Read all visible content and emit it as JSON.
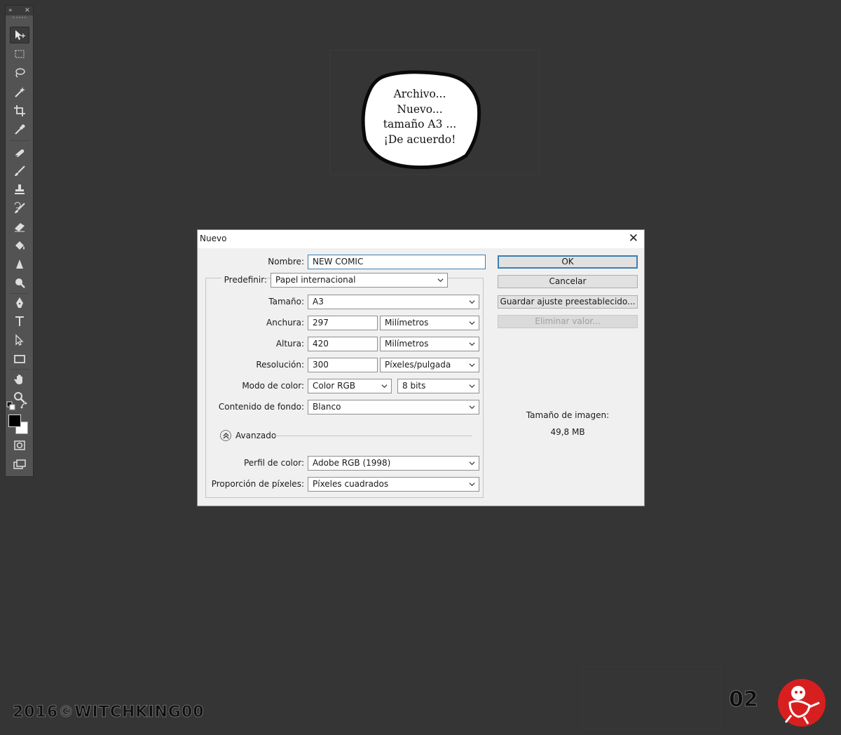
{
  "toolbar": {
    "collapse_glyph": "»",
    "close_glyph": "×",
    "tools": [
      {
        "name": "move-tool-icon",
        "active": true
      },
      {
        "name": "rectangular-marquee-icon"
      },
      {
        "name": "lasso-icon"
      },
      {
        "name": "magic-wand-icon"
      },
      {
        "name": "crop-icon"
      },
      {
        "name": "eyedropper-icon"
      },
      {
        "name": "spot-healing-icon"
      },
      {
        "name": "brush-icon"
      },
      {
        "name": "clone-stamp-icon"
      },
      {
        "name": "history-brush-icon"
      },
      {
        "name": "eraser-icon"
      },
      {
        "name": "paint-bucket-icon"
      },
      {
        "name": "blur-icon"
      },
      {
        "name": "dodge-icon"
      },
      {
        "name": "pen-icon"
      },
      {
        "name": "type-icon"
      },
      {
        "name": "path-selection-icon"
      },
      {
        "name": "rectangle-shape-icon"
      },
      {
        "name": "hand-icon"
      },
      {
        "name": "zoom-icon"
      }
    ],
    "foreground_color": "#000000",
    "background_color": "#ffffff"
  },
  "bubble": {
    "lines": [
      "Archivo...",
      "Nuevo...",
      "tamaño A3 ...",
      "¡De acuerdo!"
    ]
  },
  "dialog": {
    "title": "Nuevo",
    "close_glyph": "✕",
    "nombre": {
      "label": "Nombre:",
      "value": "NEW COMIC"
    },
    "predefinir": {
      "label": "Predefinir:",
      "value": "Papel internacional"
    },
    "tamano": {
      "label": "Tamaño:",
      "value": "A3"
    },
    "anchura": {
      "label": "Anchura:",
      "value": "297",
      "unit": "Milímetros"
    },
    "altura": {
      "label": "Altura:",
      "value": "420",
      "unit": "Milímetros"
    },
    "resolucion": {
      "label": "Resolución:",
      "value": "300",
      "unit": "Píxeles/pulgada"
    },
    "modo_color": {
      "label": "Modo de color:",
      "value": "Color RGB",
      "bits": "8 bits"
    },
    "contenido_fondo": {
      "label": "Contenido de fondo:",
      "value": "Blanco"
    },
    "avanzado": {
      "label": "Avanzado"
    },
    "perfil_color": {
      "label": "Perfil de color:",
      "value": "Adobe RGB (1998)"
    },
    "proporcion_pixeles": {
      "label": "Proporción de píxeles:",
      "value": "Píxeles cuadrados"
    },
    "buttons": {
      "ok": "OK",
      "cancel": "Cancelar",
      "save_preset": "Guardar ajuste preestablecido...",
      "delete_preset": "Eliminar valor..."
    },
    "image_size": {
      "label": "Tamaño de imagen:",
      "value": "49,8 MB"
    }
  },
  "footer": {
    "copyright": "2016©WITCHKING00",
    "page_number": "02"
  }
}
